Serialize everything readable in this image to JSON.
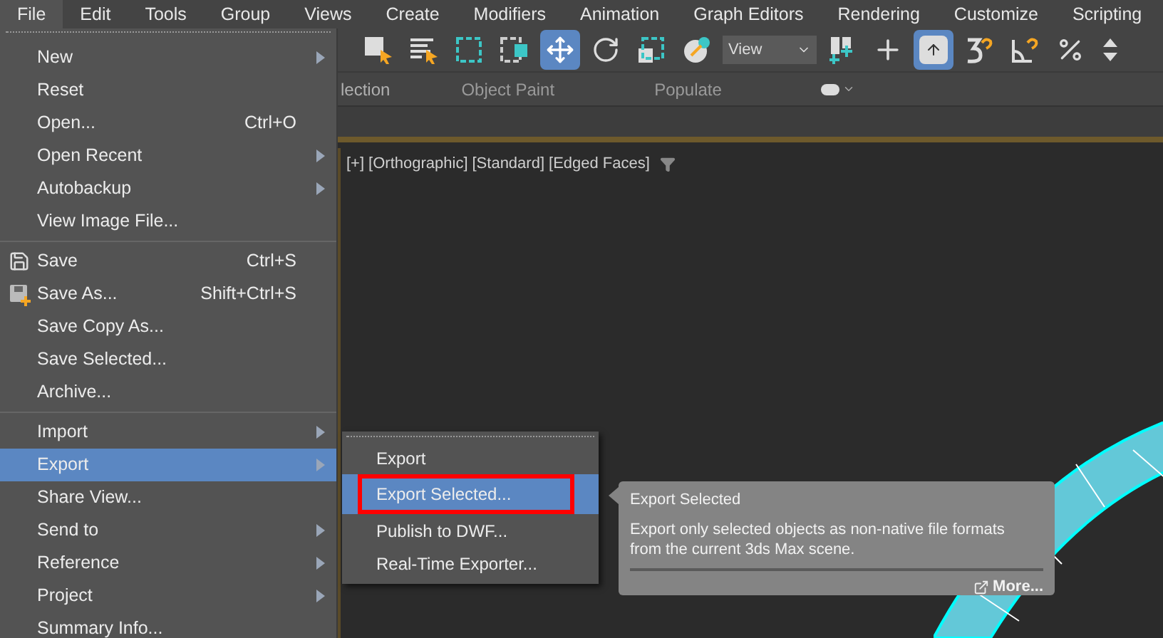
{
  "menu_bar": [
    {
      "label": "File",
      "selected": true
    },
    {
      "label": "Edit",
      "selected": false
    },
    {
      "label": "Tools",
      "selected": false
    },
    {
      "label": "Group",
      "selected": false
    },
    {
      "label": "Views",
      "selected": false
    },
    {
      "label": "Create",
      "selected": false
    },
    {
      "label": "Modifiers",
      "selected": false
    },
    {
      "label": "Animation",
      "selected": false
    },
    {
      "label": "Graph Editors",
      "selected": false
    },
    {
      "label": "Rendering",
      "selected": false
    },
    {
      "label": "Customize",
      "selected": false
    },
    {
      "label": "Scripting",
      "selected": false
    }
  ],
  "toolbar": {
    "dropdown": "View"
  },
  "ribbon_tabs": [
    "lection",
    "Object Paint",
    "Populate"
  ],
  "file_menu": [
    [
      {
        "label": "New",
        "submenu": true,
        "selected": false
      },
      {
        "label": "Reset",
        "submenu": false,
        "selected": false
      },
      {
        "label": "Open...",
        "shortcut": "Ctrl+O",
        "submenu": false,
        "selected": false
      },
      {
        "label": "Open Recent",
        "submenu": true,
        "selected": false
      },
      {
        "label": "Autobackup",
        "submenu": true,
        "selected": false
      },
      {
        "label": "View Image File...",
        "submenu": false,
        "selected": false
      }
    ],
    [
      {
        "label": "Save",
        "shortcut": "Ctrl+S",
        "submenu": false,
        "selected": false
      },
      {
        "label": "Save As...",
        "shortcut": "Shift+Ctrl+S",
        "submenu": false,
        "selected": false
      },
      {
        "label": "Save Copy As...",
        "submenu": false,
        "selected": false
      },
      {
        "label": "Save Selected...",
        "submenu": false,
        "selected": false
      },
      {
        "label": "Archive...",
        "submenu": false,
        "selected": false
      }
    ],
    [
      {
        "label": "Import",
        "submenu": true,
        "selected": false
      },
      {
        "label": "Export",
        "submenu": true,
        "selected": true
      },
      {
        "label": "Share View...",
        "submenu": false,
        "selected": false
      },
      {
        "label": "Send to",
        "submenu": true,
        "selected": false
      },
      {
        "label": "Reference",
        "submenu": true,
        "selected": false
      },
      {
        "label": "Project",
        "submenu": true,
        "selected": false
      },
      {
        "label": "Summary Info...",
        "submenu": false,
        "selected": false
      }
    ]
  ],
  "viewport": {
    "labels": [
      "[+]",
      "[Orthographic]",
      "[Standard]",
      "[Edged Faces]"
    ]
  },
  "export_submenu": [
    {
      "label": "Export",
      "selected": false
    },
    {
      "label": "Export Selected...",
      "selected": true
    },
    {
      "label": "Publish to DWF...",
      "selected": false
    },
    {
      "label": "Real-Time Exporter...",
      "selected": false
    }
  ],
  "tooltip": {
    "title": "Export Selected",
    "description": "Export only selected objects as non-native file formats from the current 3ds Max scene.",
    "link": "More..."
  }
}
